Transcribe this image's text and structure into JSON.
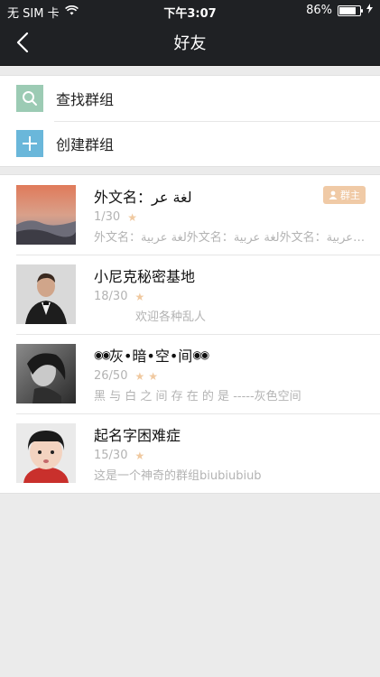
{
  "status": {
    "carrier": "无 SIM 卡",
    "time": "下午3:07",
    "battery": "86%",
    "battery_level": 0.86
  },
  "nav": {
    "title": "好友"
  },
  "actions": [
    {
      "label": "查找群组",
      "icon": "search-icon",
      "color": "#9ccbb4"
    },
    {
      "label": "创建群组",
      "icon": "plus-icon",
      "color": "#6ab7da"
    }
  ],
  "groups": [
    {
      "name": "外文名：لغة عر",
      "count": "1/30",
      "stars": 1,
      "desc": "外文名：لغة عربية外文名：لغة عربية外文名：لغة عربية",
      "owner_badge": "群主"
    },
    {
      "name": "小尼克秘密基地",
      "count": "18/30",
      "stars": 1,
      "desc": "欢迎各种乱人"
    },
    {
      "name": "灰•暗•空•间",
      "count": "26/50",
      "stars": 2,
      "desc": "黑 与 白 之 间 存 在 的 是 -----灰色空间"
    },
    {
      "name": "起名字困难症",
      "count": "15/30",
      "stars": 1,
      "desc": "这是一个神奇的群组biubiubiub"
    }
  ]
}
